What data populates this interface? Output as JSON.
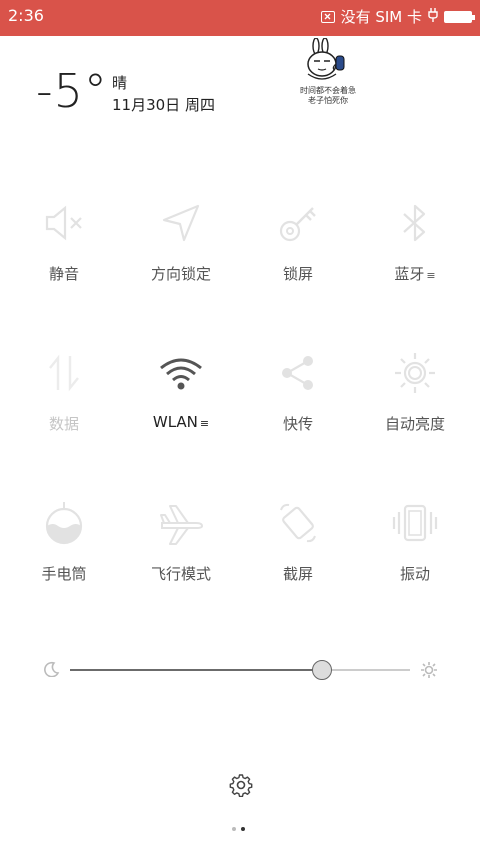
{
  "status_bar": {
    "time": "2:36",
    "sim_text": "没有 SIM 卡",
    "background_color": "#d9534a"
  },
  "weather": {
    "temperature": "-5°",
    "condition": "晴",
    "date": "11月30日 周四"
  },
  "sticker": {
    "caption_line1": "时间都不会着急",
    "caption_line2": "老子怕死你"
  },
  "toggles": [
    {
      "label": "静音",
      "icon": "mute-icon",
      "state": "off"
    },
    {
      "label": "方向锁定",
      "icon": "rotation-lock-icon",
      "state": "off"
    },
    {
      "label": "锁屏",
      "icon": "key-icon",
      "state": "off"
    },
    {
      "label": "蓝牙",
      "icon": "bluetooth-icon",
      "state": "off",
      "has_more": true
    },
    {
      "label": "数据",
      "icon": "mobile-data-icon",
      "state": "disabled"
    },
    {
      "label": "WLAN",
      "icon": "wifi-icon",
      "state": "on",
      "has_more": true
    },
    {
      "label": "快传",
      "icon": "share-icon",
      "state": "off"
    },
    {
      "label": "自动亮度",
      "icon": "auto-brightness-icon",
      "state": "off"
    },
    {
      "label": "手电筒",
      "icon": "flashlight-icon",
      "state": "off"
    },
    {
      "label": "飞行模式",
      "icon": "airplane-icon",
      "state": "off"
    },
    {
      "label": "截屏",
      "icon": "screenshot-icon",
      "state": "off"
    },
    {
      "label": "振动",
      "icon": "vibrate-icon",
      "state": "off"
    }
  ],
  "brightness": {
    "level_fraction": 0.74,
    "min_icon": "moon-icon",
    "max_icon": "sun-icon"
  },
  "footer": {
    "settings_icon": "gear-icon",
    "page_count": 2,
    "active_page": 2
  }
}
